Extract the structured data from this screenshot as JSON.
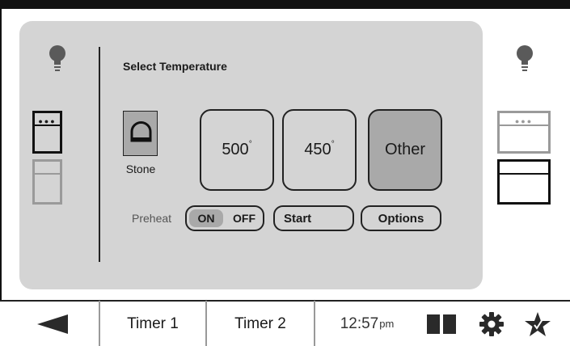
{
  "panel": {
    "title": "Select Temperature"
  },
  "stone": {
    "label": "Stone",
    "icon": "stone-oven-icon"
  },
  "temperatures": {
    "t500": "500",
    "t450": "450",
    "degree": "°",
    "other": "Other",
    "selected": "Other"
  },
  "controls": {
    "preheat_label": "Preheat",
    "on_label": "ON",
    "off_label": "OFF",
    "preheat_state": "ON",
    "start_label": "Start",
    "options_label": "Options"
  },
  "side": {
    "left_selected_oven": "upper",
    "right_selected_oven": "lower"
  },
  "bottom_bar": {
    "back_icon": "back-arrow-icon",
    "timer1_label": "Timer 1",
    "timer2_label": "Timer 2",
    "time_value": "12:57",
    "time_suffix": "pm",
    "split_icon": "split-view-icon",
    "settings_icon": "gear-icon",
    "favorites_icon": "star-icon"
  },
  "colors": {
    "panel_bg": "#d4d4d4",
    "selected_fill": "#a9a9a9",
    "outline": "#222222",
    "inactive_oven": "#9a9a9a"
  }
}
